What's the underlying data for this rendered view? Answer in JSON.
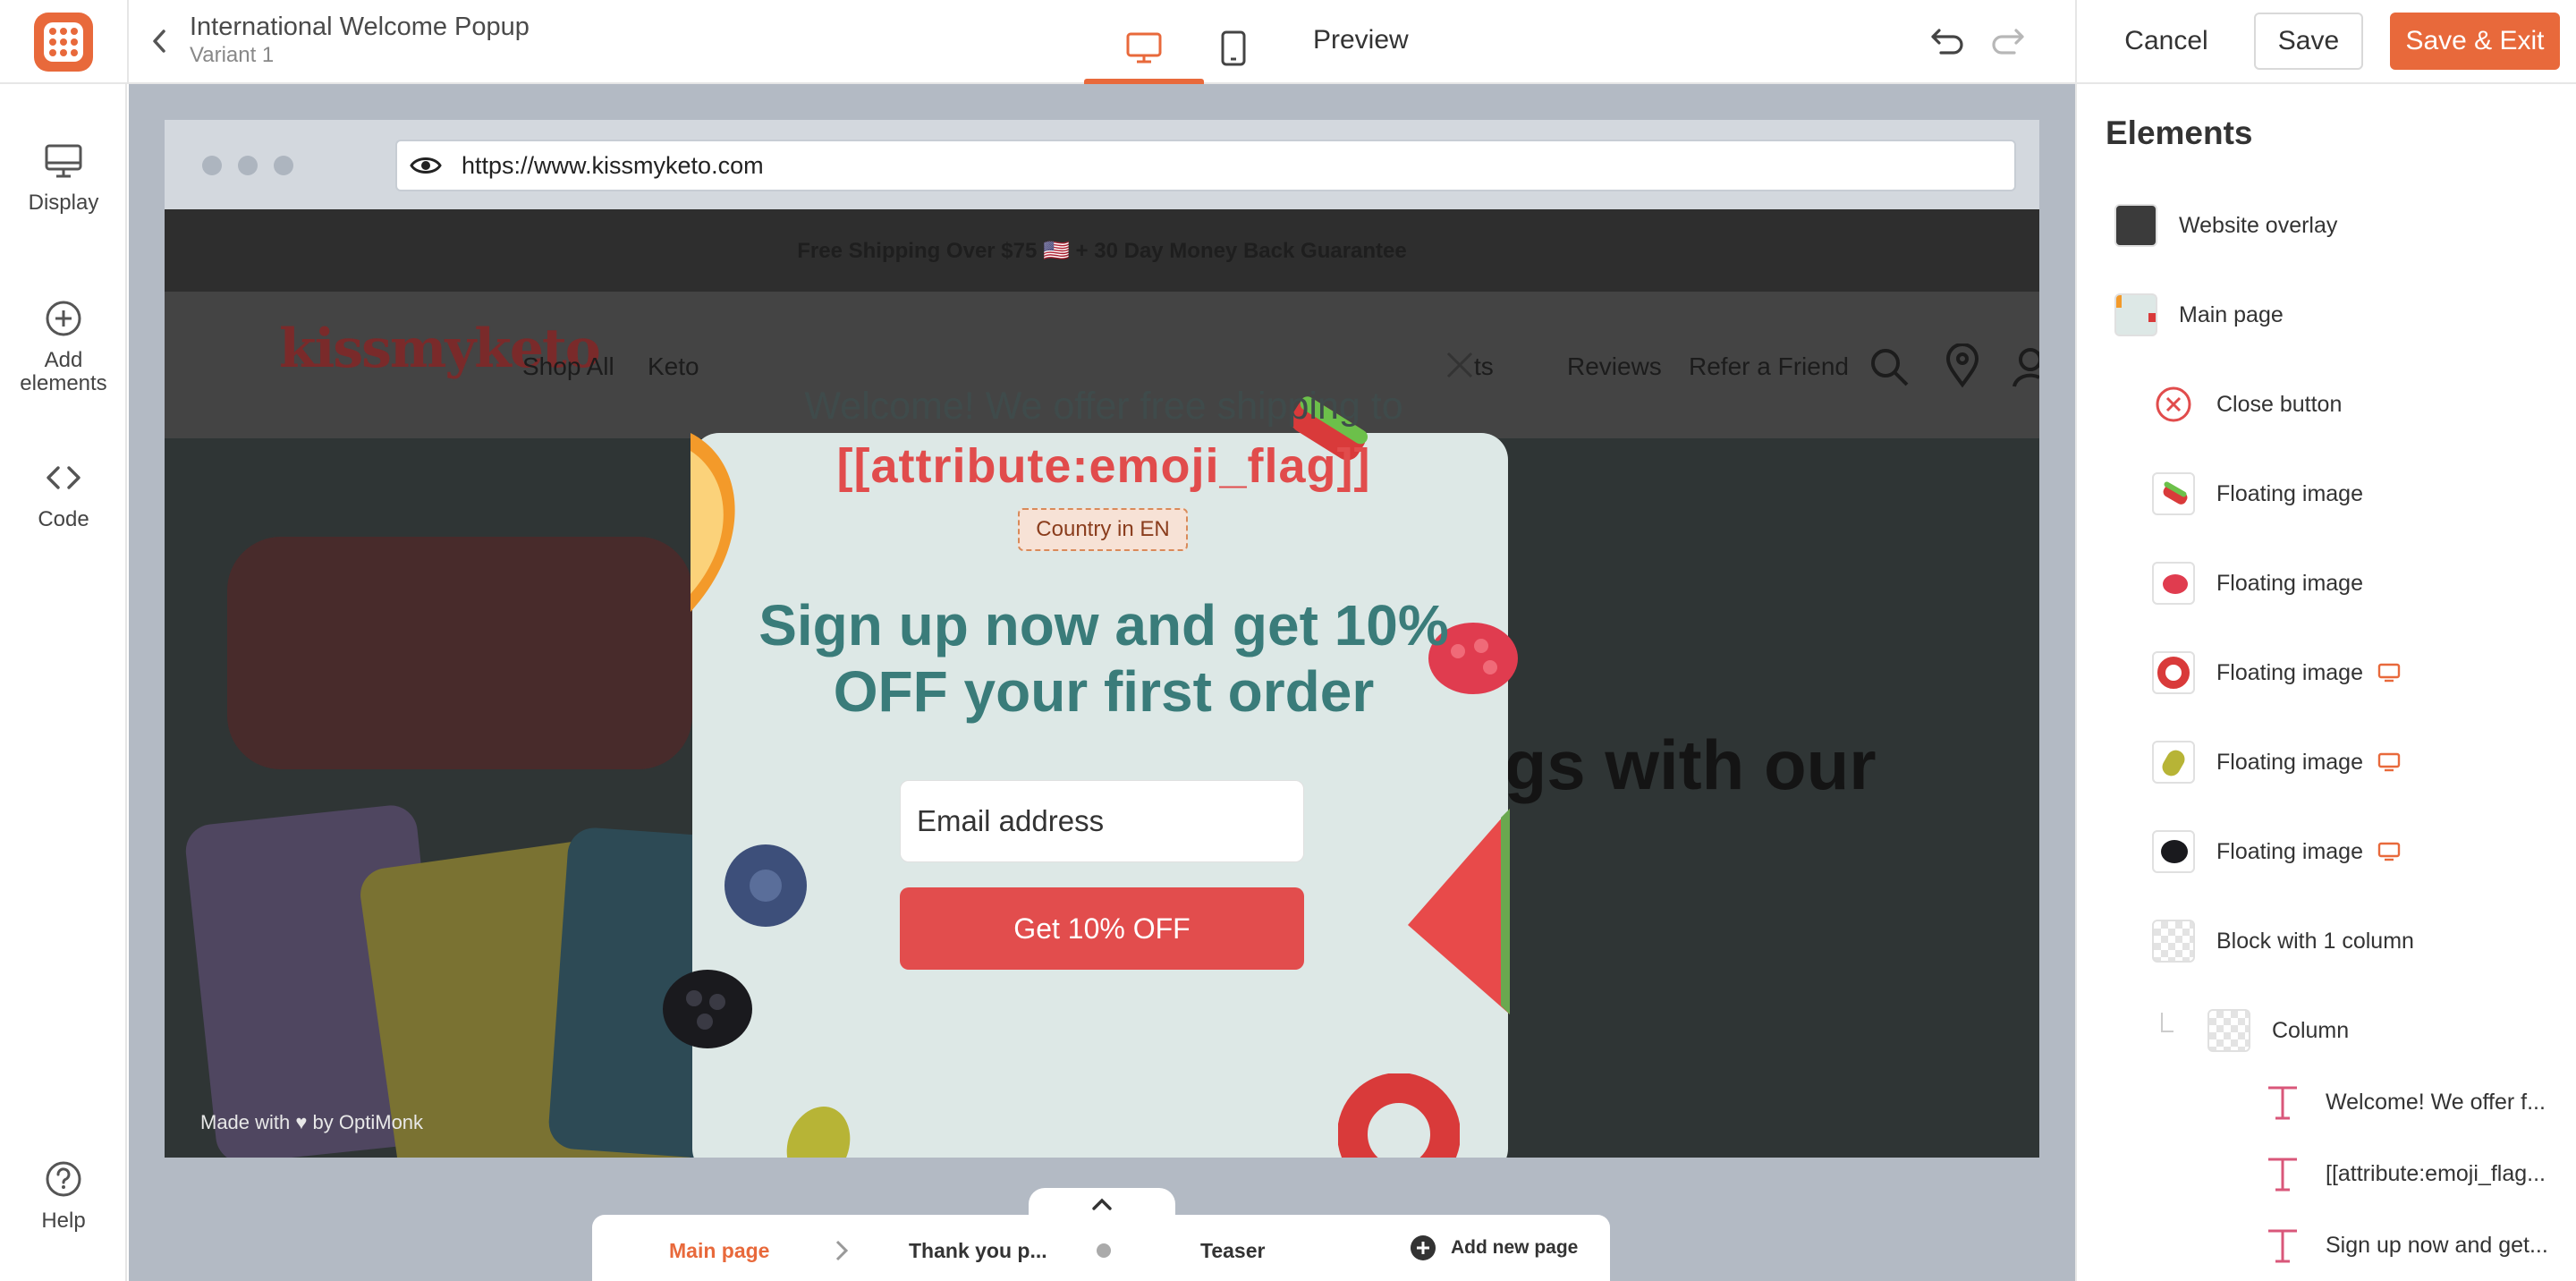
{
  "header": {
    "campaign_title": "International Welcome Popup",
    "variant": "Variant 1",
    "preview_label": "Preview",
    "cancel_label": "Cancel",
    "save_label": "Save",
    "save_exit_label": "Save & Exit",
    "active_device": "desktop"
  },
  "left_sidebar": {
    "items": [
      {
        "label": "Display",
        "icon": "monitor-icon"
      },
      {
        "label": "Add elements",
        "icon": "plus-circle-icon"
      },
      {
        "label": "Code",
        "icon": "code-icon"
      },
      {
        "label": "Help",
        "icon": "help-icon"
      }
    ]
  },
  "browser": {
    "url": "https://www.kissmyketo.com"
  },
  "website": {
    "announcement": "Free Shipping Over $75 🇺🇸 + 30 Day Money Back Guarantee",
    "logo_text": "kissmyketo",
    "nav": [
      "Shop All",
      "Keto",
      "ts",
      "Reviews",
      "Refer a Friend"
    ],
    "hero_text": "ngs with our",
    "made_with": "Made with ♥ by OptiMonk"
  },
  "popup": {
    "title_line1": "Welcome! We offer free shipping to",
    "title_line2": "[[attribute:emoji_flag]]",
    "country_badge": "Country in EN",
    "headline": "Sign up now and get 10% OFF your first order",
    "email_placeholder": "Email address",
    "cta_label": "Get 10% OFF"
  },
  "page_tabs": {
    "tabs": [
      {
        "label": "Main page",
        "active": true
      },
      {
        "label": "Thank you p...",
        "active": false
      },
      {
        "label": "Teaser",
        "active": false
      }
    ],
    "add_label": "Add new page"
  },
  "elements_panel": {
    "title": "Elements",
    "items": [
      {
        "label": "Website overlay",
        "thumb": "overlay"
      },
      {
        "label": "Main page",
        "thumb": "page"
      },
      {
        "label": "Close button",
        "thumb": "close-icon"
      },
      {
        "label": "Floating image",
        "thumb": "gummy-watermelon"
      },
      {
        "label": "Floating image",
        "thumb": "raspberry"
      },
      {
        "label": "Floating image",
        "thumb": "ring",
        "desktop_only": true
      },
      {
        "label": "Floating image",
        "thumb": "gummy-bear",
        "desktop_only": true
      },
      {
        "label": "Floating image",
        "thumb": "blackberry",
        "desktop_only": true
      },
      {
        "label": "Block with 1 column",
        "thumb": "checker"
      },
      {
        "label": "Column",
        "thumb": "checker"
      },
      {
        "label": "Welcome! We offer f...",
        "thumb": "text"
      },
      {
        "label": "[[attribute:emoji_flag...",
        "thumb": "text"
      },
      {
        "label": "Sign up now and get...",
        "thumb": "text"
      }
    ]
  },
  "colors": {
    "brand_orange": "#e8693b",
    "popup_bg": "#dde8e6",
    "cta_red": "#e24d4d",
    "headline_teal": "#3a7c7a"
  }
}
